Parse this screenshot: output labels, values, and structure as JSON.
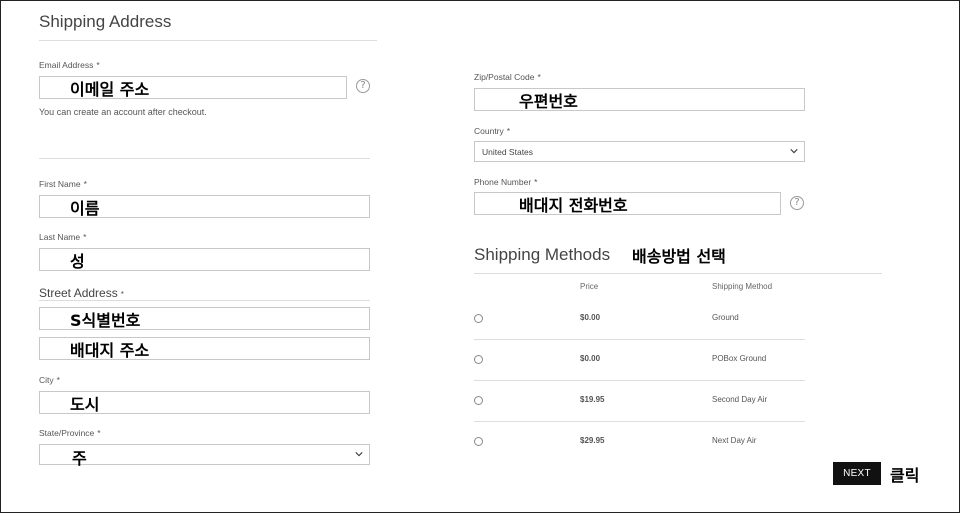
{
  "shipping_address": {
    "title": "Shipping Address",
    "email": {
      "label": "Email Address",
      "required": "*",
      "value": "이메일 주소",
      "hint": "You can create an account after checkout."
    },
    "first_name": {
      "label": "First Name",
      "required": "*",
      "value": "이름"
    },
    "last_name": {
      "label": "Last Name",
      "required": "*",
      "value": "성"
    },
    "street": {
      "label": "Street Address",
      "required": "*",
      "line1": "S식별번호",
      "line2": "배대지 주소"
    },
    "city": {
      "label": "City",
      "required": "*",
      "value": "도시"
    },
    "state": {
      "label": "State/Province",
      "required": "*",
      "value": "주"
    },
    "zip": {
      "label": "Zip/Postal Code",
      "required": "*",
      "value": "우편번호"
    },
    "country": {
      "label": "Country",
      "required": "*",
      "value": "United States"
    },
    "phone": {
      "label": "Phone Number",
      "required": "*",
      "value": "배대지 전화번호"
    }
  },
  "shipping_methods": {
    "title": "Shipping Methods",
    "annotation": "배송방법 선택",
    "headers": {
      "price": "Price",
      "method": "Shipping Method"
    },
    "rows": [
      {
        "price": "$0.00",
        "method": "Ground"
      },
      {
        "price": "$0.00",
        "method": "POBox Ground"
      },
      {
        "price": "$19.95",
        "method": "Second Day Air"
      },
      {
        "price": "$29.95",
        "method": "Next Day Air"
      }
    ]
  },
  "actions": {
    "next_label": "NEXT",
    "next_annotation": "클릭"
  },
  "icons": {
    "help": "help-icon",
    "chevron": "chevron-down-icon"
  }
}
